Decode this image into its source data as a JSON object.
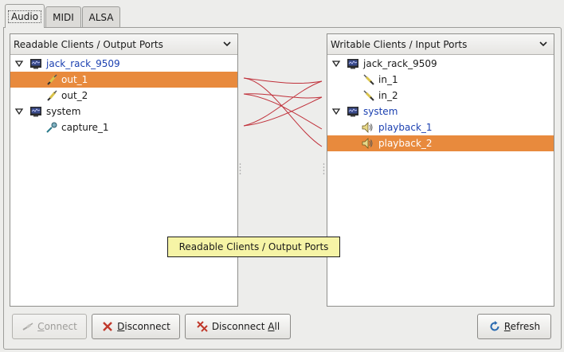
{
  "tabs": [
    {
      "label": "Audio",
      "active": true
    },
    {
      "label": "MIDI",
      "active": false
    },
    {
      "label": "ALSA",
      "active": false
    }
  ],
  "readable": {
    "header": "Readable Clients / Output Ports",
    "clients": [
      {
        "name": "jack_rack_9509",
        "ports": [
          "out_1",
          "out_2"
        ]
      },
      {
        "name": "system",
        "ports": [
          "capture_1"
        ]
      }
    ],
    "selected_port": "out_1"
  },
  "writable": {
    "header": "Writable Clients / Input Ports",
    "clients": [
      {
        "name": "jack_rack_9509",
        "ports": [
          "in_1",
          "in_2"
        ]
      },
      {
        "name": "system",
        "ports": [
          "playback_1",
          "playback_2"
        ]
      }
    ],
    "selected_port": "playback_2"
  },
  "tooltip": "Readable Clients / Output Ports",
  "buttons": {
    "connect": {
      "mnemonic": "C",
      "rest": "onnect"
    },
    "disconnect": {
      "mnemonic": "D",
      "rest": "isconnect"
    },
    "disconnect_all": {
      "prefix": "Disconnect ",
      "mnemonic": "A",
      "rest": "ll"
    },
    "refresh": {
      "mnemonic": "R",
      "rest": "efresh"
    }
  },
  "colors": {
    "selection": "#e88a3d",
    "link_text": "#1a3fb0",
    "connection_line": "#c0303a",
    "tooltip_bg": "#f6f4a6"
  },
  "icons": {
    "client": "client-monitor-icon",
    "output_port": "jack-plug-icon",
    "capture_port": "microphone-icon",
    "input_port": "jack-plug-icon",
    "playback_port": "speaker-icon"
  }
}
